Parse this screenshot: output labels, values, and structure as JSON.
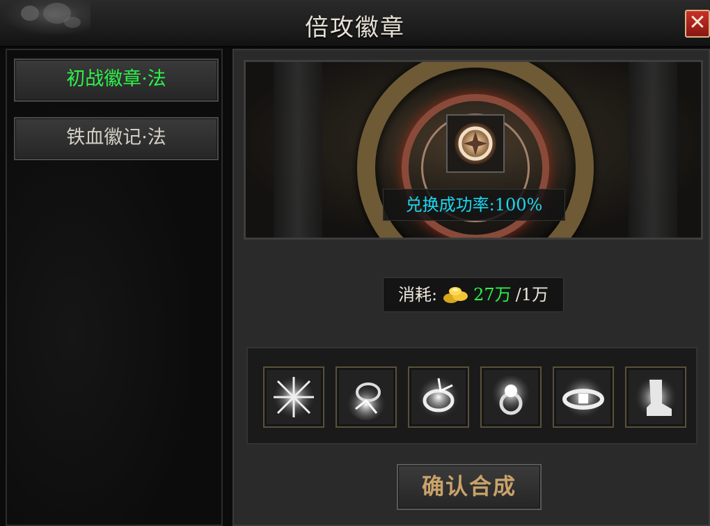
{
  "window": {
    "title": "倍攻徽章",
    "close_label": "✕"
  },
  "sidebar": {
    "items": [
      {
        "label": "初战徽章·法",
        "active": true
      },
      {
        "label": "铁血徽记·法",
        "active": false
      }
    ]
  },
  "forge": {
    "success_rate": "兑换成功率:100%"
  },
  "cost": {
    "label": "消耗:",
    "have": "27万",
    "need": "/1万",
    "currency_icon": "gold-ingot-icon"
  },
  "materials": [
    {
      "icon": "weapon-icon"
    },
    {
      "icon": "necklace-icon"
    },
    {
      "icon": "bracelet-icon"
    },
    {
      "icon": "ring-icon"
    },
    {
      "icon": "belt-icon"
    },
    {
      "icon": "boots-icon"
    }
  ],
  "confirm_label": "确认合成",
  "colors": {
    "active_text": "#2df34a",
    "rate_text": "#19d9f2",
    "confirm_text": "#c9a36a",
    "close_bg": "#b4231d"
  }
}
